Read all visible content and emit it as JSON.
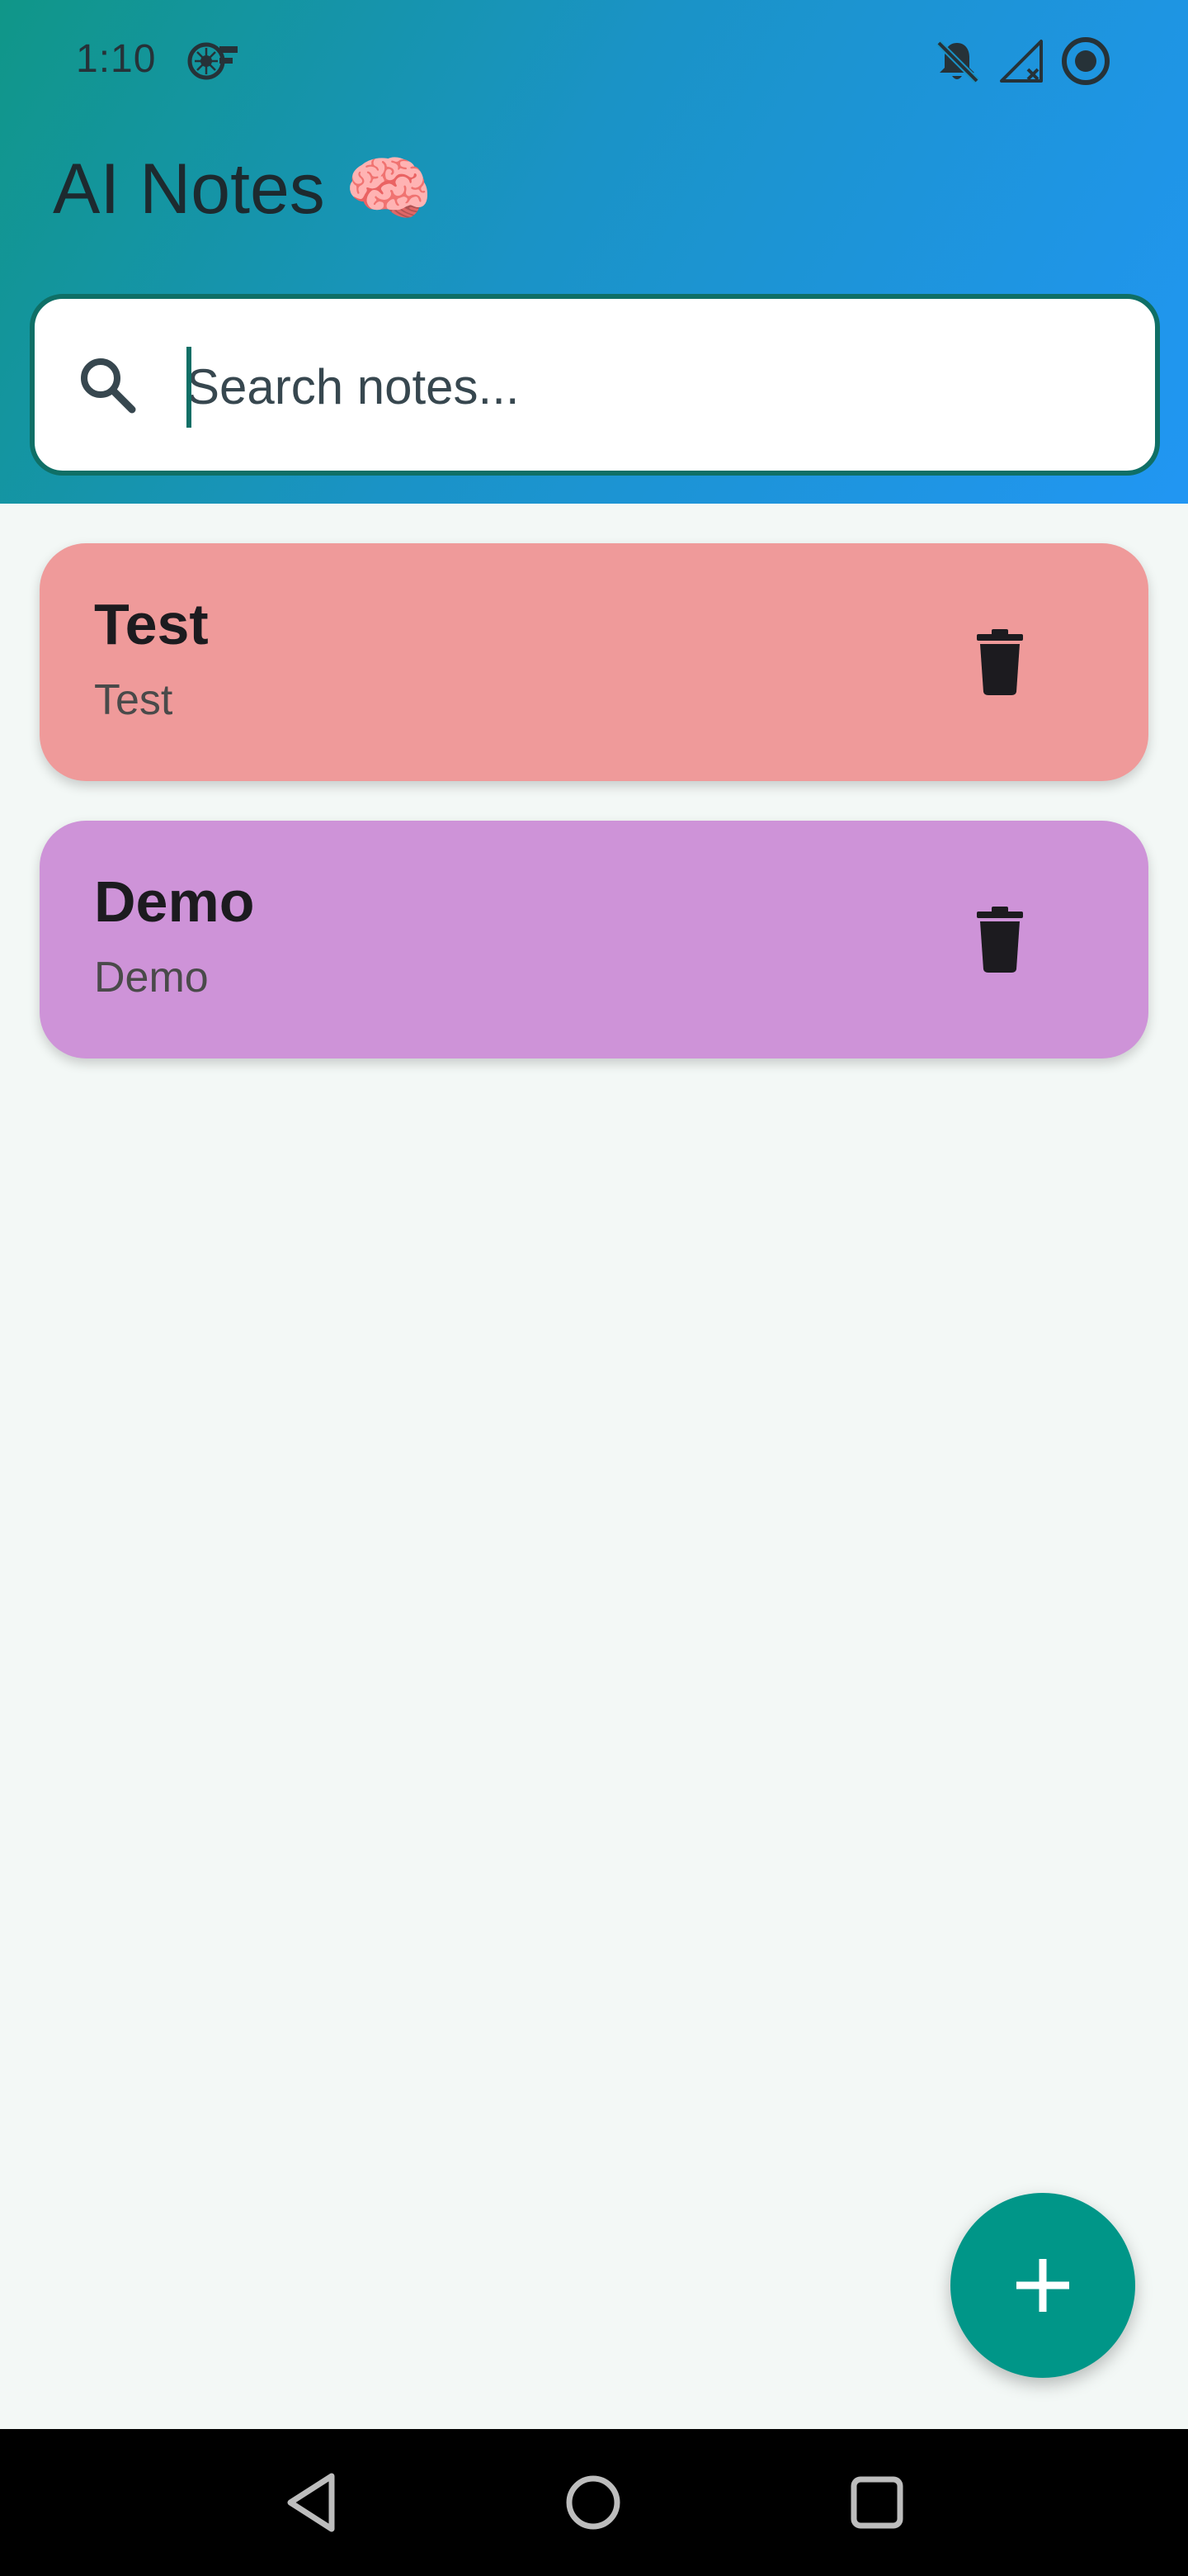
{
  "status_bar": {
    "time": "1:10",
    "icons": [
      "fan-icon",
      "bell-off-icon",
      "signal-off-icon",
      "sync-icon"
    ]
  },
  "app": {
    "title": "AI Notes 🧠"
  },
  "search": {
    "placeholder": "Search notes...",
    "value": ""
  },
  "notes": [
    {
      "title": "Test",
      "body": "Test",
      "color": "#ef9a9a"
    },
    {
      "title": "Demo",
      "body": "Demo",
      "color": "#ce93d8"
    }
  ],
  "colors": {
    "accent": "#009688",
    "search_border": "#0f6f66",
    "background": "#f3f8f6"
  },
  "fab": {
    "icon": "plus-icon"
  },
  "nav_bar": {
    "icons": [
      "back-icon",
      "home-icon",
      "recents-icon"
    ]
  }
}
